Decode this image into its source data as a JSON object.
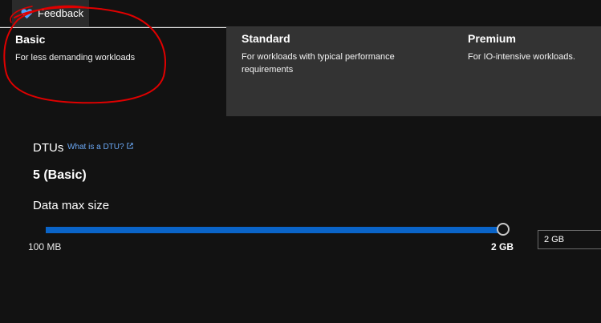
{
  "feedback": {
    "label": "Feedback",
    "icon": "heart-icon",
    "icon_color": "#4da3ff"
  },
  "tiers": [
    {
      "name": "Basic",
      "description": "For less demanding workloads",
      "selected": true
    },
    {
      "name": "Standard",
      "description": "For workloads with typical performance requirements",
      "selected": false
    },
    {
      "name": "Premium",
      "description": "For IO-intensive workloads.",
      "selected": false
    }
  ],
  "annotation": {
    "color": "#e00000",
    "shape": "hand-drawn circle around Basic tier"
  },
  "dtu": {
    "label": "DTUs",
    "link_text": "What is a DTU?",
    "link_icon": "external-link-icon",
    "value": "5 (Basic)"
  },
  "data_max_size": {
    "label": "Data max size",
    "min_label": "100 MB",
    "max_label": "2 GB",
    "slider_fraction": 1.0,
    "input_value": "2 GB"
  },
  "colors": {
    "background": "#121212",
    "unselected_tier": "#333333",
    "slider_fill": "#0a64c8",
    "link": "#6ba8f5"
  }
}
